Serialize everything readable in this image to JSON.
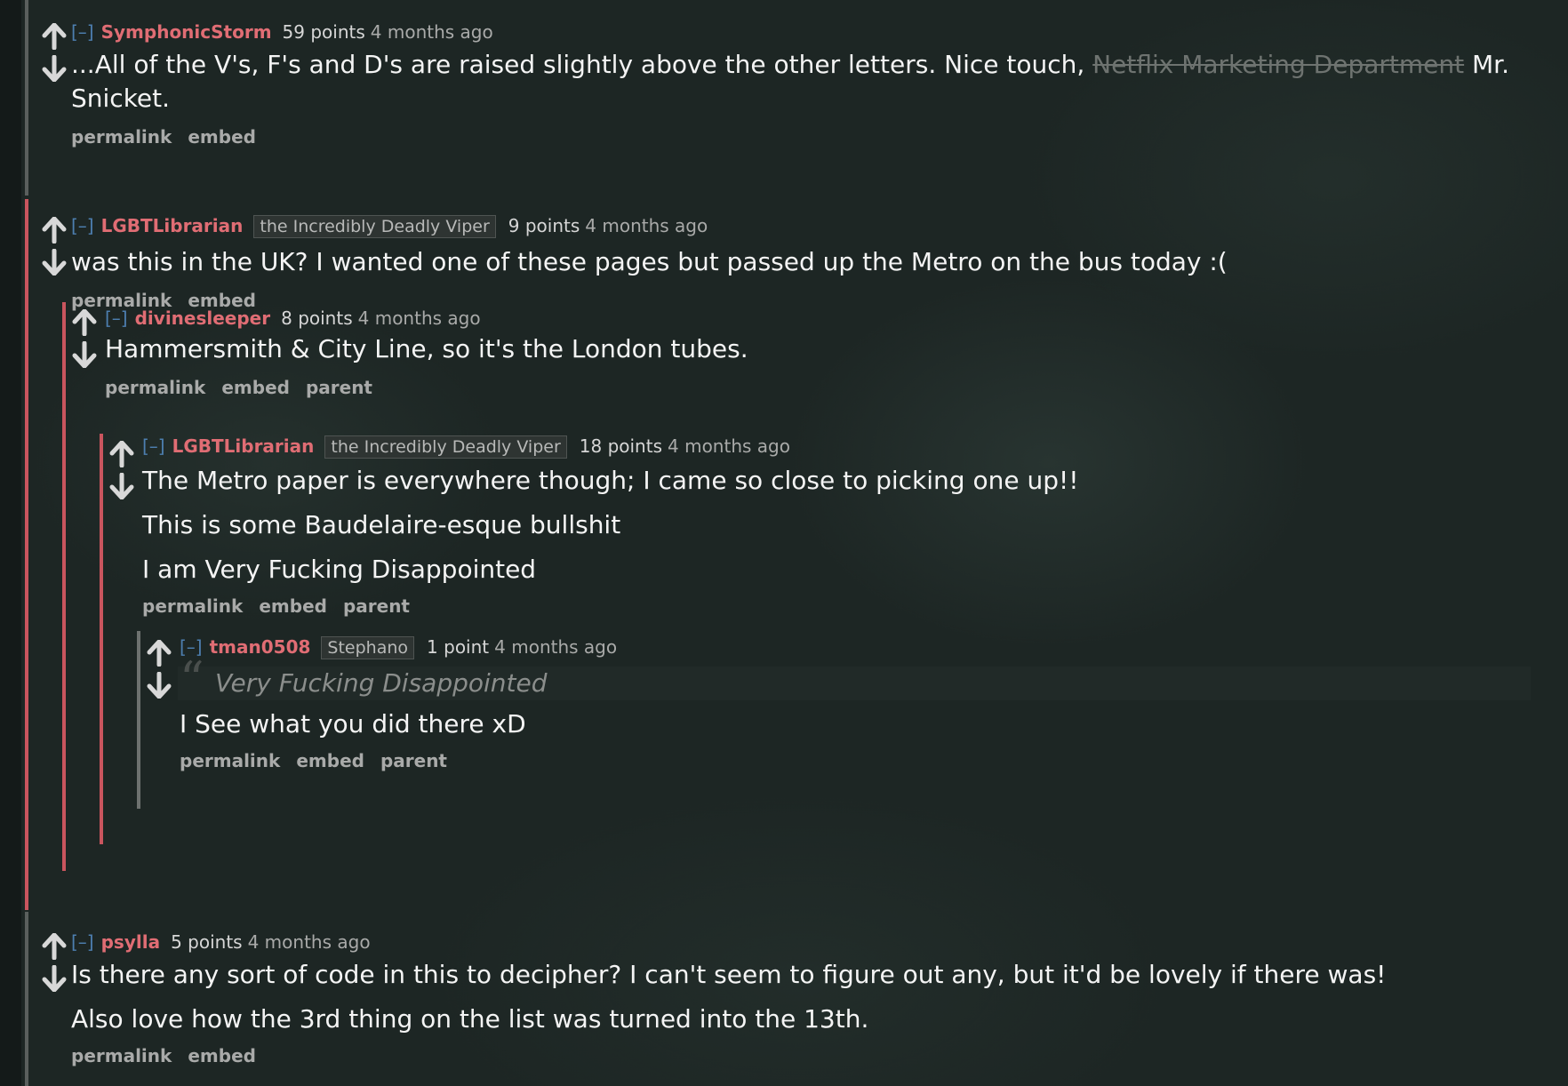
{
  "labels": {
    "expand": "[–]",
    "permalink": "permalink",
    "embed": "embed",
    "parent": "parent"
  },
  "comments": [
    {
      "author": "SymphonicStorm",
      "score": "59 points",
      "age": "4 months ago",
      "body_pre": "...All of the V's, F's and D's are raised slightly above the other letters. Nice touch, ",
      "body_strike": "Netflix Marketing Department",
      "body_post": " Mr. Snicket."
    },
    {
      "author": "LGBTLibrarian",
      "flair": "the Incredibly Deadly Viper",
      "score": "9 points",
      "age": "4 months ago",
      "body": "was this in the UK? I wanted one of these pages but passed up the Metro on the bus today :(",
      "replies": [
        {
          "author": "divinesleeper",
          "score": "8 points",
          "age": "4 months ago",
          "body": "Hammersmith & City Line, so it's the London tubes.",
          "replies": [
            {
              "author": "LGBTLibrarian",
              "flair": "the Incredibly Deadly Viper",
              "score": "18 points",
              "age": "4 months ago",
              "paragraphs": [
                "The Metro paper is everywhere though; I came so close to picking one up!!",
                "This is some Baudelaire-esque bullshit",
                "I am Very Fucking Disappointed"
              ],
              "replies": [
                {
                  "author": "tman0508",
                  "flair": "Stephano",
                  "score": "1 point",
                  "age": "4 months ago",
                  "quote": "Very Fucking Disappointed",
                  "body": "I See what you did there xD"
                }
              ]
            }
          ]
        }
      ]
    },
    {
      "author": "psylla",
      "score": "5 points",
      "age": "4 months ago",
      "paragraphs": [
        "Is there any sort of code in this to decipher? I can't seem to figure out any, but it'd be lovely if there was!",
        "Also love how the 3rd thing on the list was turned into the 13th."
      ]
    }
  ]
}
